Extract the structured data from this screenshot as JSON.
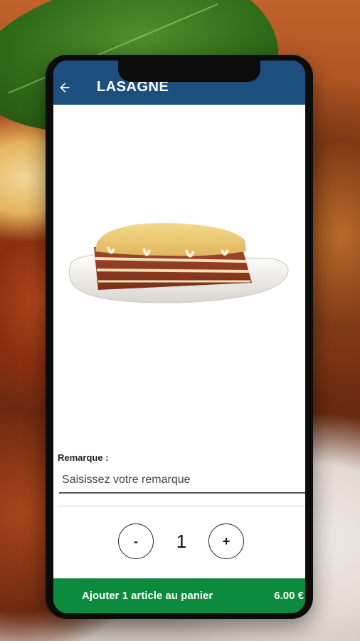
{
  "app_bar": {
    "title": "LASAGNE",
    "background_color": "#1c4f7e",
    "back_icon": "arrow-left-icon"
  },
  "product": {
    "image": "lasagne-on-plate"
  },
  "remark": {
    "label": "Remarque :",
    "placeholder": "Saisissez votre remarque",
    "value": ""
  },
  "quantity": {
    "minus_label": "-",
    "value": "1",
    "plus_label": "+"
  },
  "cart": {
    "button_label": "Ajouter 1 article au panier",
    "price": "6.00 €",
    "background_color": "#0c8a3e"
  }
}
